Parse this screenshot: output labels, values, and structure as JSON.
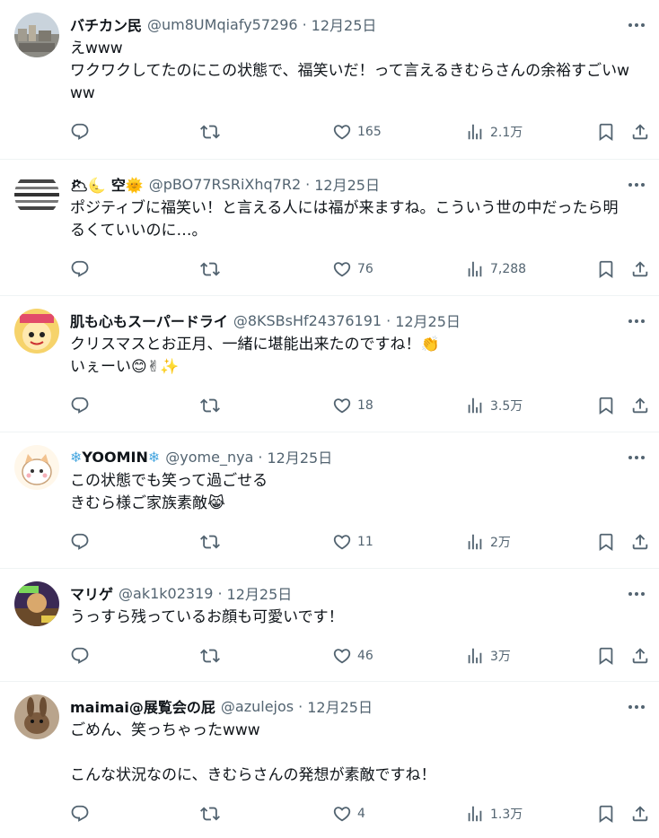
{
  "tweets": [
    {
      "name": "バチカン民",
      "handle": "@um8UMqiafy57296",
      "dot": "·",
      "date": "12月25日",
      "text": "えwww\nワクワクしてたのにこの状態で、福笑いだ！って言えるきむらさんの余裕すごいwww",
      "replies": "",
      "retweets": "",
      "likes": "165",
      "views": "2.1万",
      "avatar_icon": "city-photo-avatar"
    },
    {
      "name_prefix_icons": [
        "cloud-icon",
        "moon-icon"
      ],
      "name": "空",
      "name_suffix_icon": "sun-icon",
      "handle": "@pBO77RSRiXhq7R2",
      "dot": "·",
      "date": "12月25日",
      "text": "ポジティブに福笑い！と言える人には福が来ますね。こういう世の中だったら明るくていいのに…。",
      "likes": "76",
      "views": "7,288",
      "avatar_icon": "striped-avatar"
    },
    {
      "name": "肌も心もスーパードライ",
      "handle": "@8KSBsHf24376191",
      "dot": "·",
      "date": "12月25日",
      "text_line1": "クリスマスとお正月、一緒に堪能出来たのですね！",
      "text_line2": "いぇーい",
      "text_icons": [
        "clap-icon",
        "smile-icon",
        "victory-icon",
        "sparkles-icon"
      ],
      "likes": "18",
      "views": "3.5万",
      "avatar_icon": "cartoon-avatar"
    },
    {
      "name_prefix_icon": "snowflake-icon",
      "name": "YOOMIN",
      "name_suffix_icon": "snowflake-icon",
      "handle": "@yome_nya",
      "dot": "·",
      "date": "12月25日",
      "text_line1": "この状態でも笑って過ごせる",
      "text_line2": "きむら様ご家族素敵",
      "text_icons": [
        "crying-laughing-cat-icon"
      ],
      "likes": "11",
      "views": "2万",
      "avatar_icon": "cat-illustration-avatar"
    },
    {
      "name": "マリゲ",
      "handle": "@ak1k02319",
      "dot": "·",
      "date": "12月25日",
      "text": "うっすら残っているお顔も可愛いです！",
      "likes": "46",
      "views": "3万",
      "avatar_icon": "game-avatar"
    },
    {
      "name": "maimai@展覧会の屁",
      "handle": "@azulejos",
      "dot": "·",
      "date": "12月25日",
      "text": "ごめん、笑っちゃったwww\n\nこんな状況なのに、きむらさんの発想が素敵ですね！",
      "likes": "4",
      "views": "1.3万",
      "avatar_icon": "rabbit-photo-avatar"
    }
  ],
  "icons": {
    "reply": "reply-icon",
    "retweet": "retweet-icon",
    "like": "heart-icon",
    "views": "views-chart-icon",
    "bookmark": "bookmark-icon",
    "share": "share-icon",
    "more": "more-icon"
  },
  "colors": {
    "text": "#0f1419",
    "secondary": "#536471",
    "divider": "#eff3f4"
  }
}
